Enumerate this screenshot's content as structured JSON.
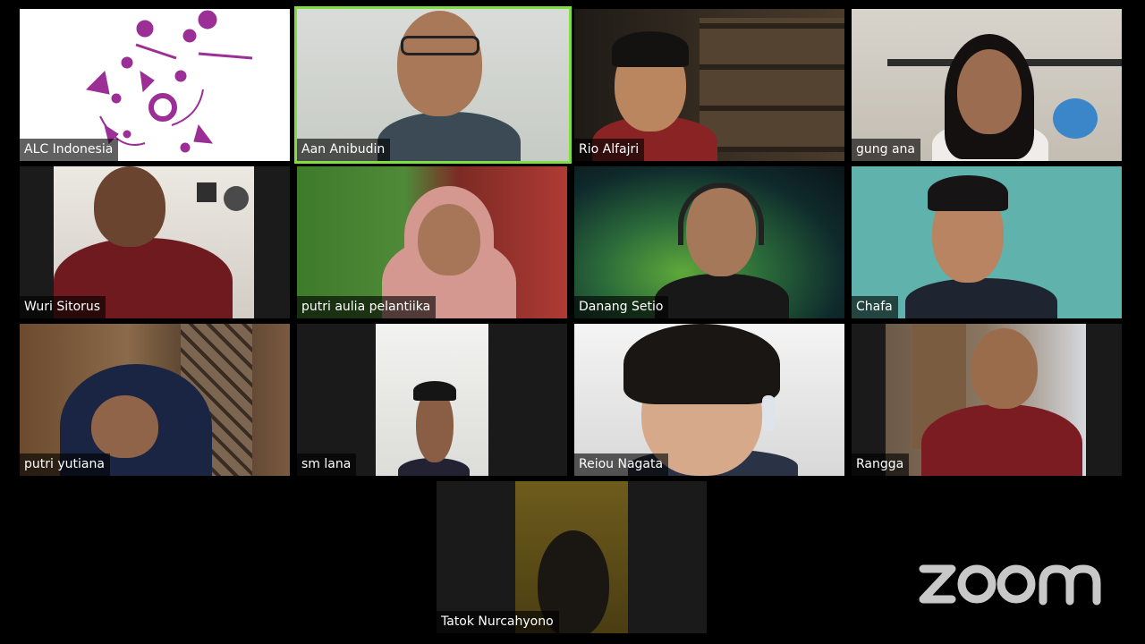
{
  "app": {
    "name": "Zoom",
    "logo_text": "zoom"
  },
  "participants": [
    {
      "name": "ALC Indonesia",
      "speaking": false
    },
    {
      "name": "Aan Anibudin",
      "speaking": true
    },
    {
      "name": "Rio Alfajri",
      "speaking": false
    },
    {
      "name": "gung ana",
      "speaking": false
    },
    {
      "name": "Wuri Sitorus",
      "speaking": false
    },
    {
      "name": "putri aulia pelantiika",
      "speaking": false
    },
    {
      "name": "Danang Setio",
      "speaking": false
    },
    {
      "name": "Chafa",
      "speaking": false
    },
    {
      "name": "putri yutiana",
      "speaking": false
    },
    {
      "name": "sm lana",
      "speaking": false
    },
    {
      "name": "Reiou Nagata",
      "speaking": false
    },
    {
      "name": "Rangga",
      "speaking": false
    },
    {
      "name": "Tatok Nurcahyono",
      "speaking": false
    }
  ],
  "colors": {
    "background": "#000000",
    "active_speaker_border": "#7ee03f",
    "label_text": "#ffffff",
    "logo": "#c8c8c8",
    "alc_logo": "#9b2f96"
  }
}
